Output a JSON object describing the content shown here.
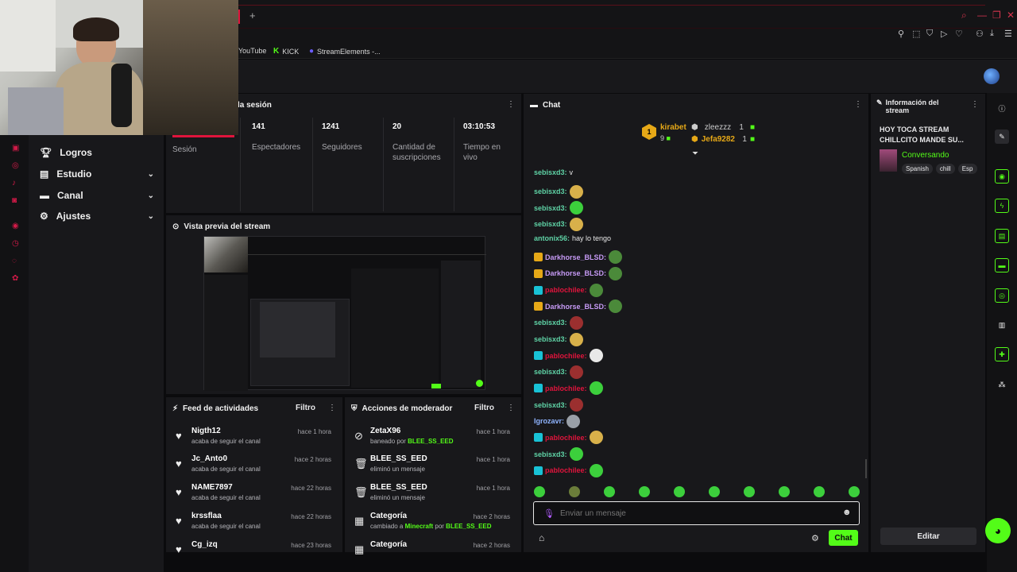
{
  "browser": {
    "new_tab": "+",
    "bookmarks": [
      {
        "icon": "youtube-icon",
        "label": "YouTube"
      },
      {
        "icon": "kick-icon",
        "label": "KICK"
      },
      {
        "icon": "streamelements-icon",
        "label": "StreamElements -..."
      }
    ]
  },
  "sidebar": {
    "items": [
      {
        "label": "Logros",
        "icon": "trophy-icon",
        "chevron": false
      },
      {
        "label": "Estudio",
        "icon": "studio-icon",
        "chevron": true
      },
      {
        "label": "Canal",
        "icon": "channel-icon",
        "chevron": true
      },
      {
        "label": "Ajustes",
        "icon": "gear-icon",
        "chevron": true
      }
    ]
  },
  "session": {
    "title": "la sesión",
    "left_label": "Sesión",
    "stats": [
      {
        "value": "141",
        "label": "Espectadores"
      },
      {
        "value": "1241",
        "label": "Seguidores"
      },
      {
        "value": "20",
        "label": "Cantidad de suscripciones"
      },
      {
        "value": "03:10:53",
        "label": "Tiempo en vivo"
      }
    ]
  },
  "preview": {
    "title": "Vista previa del stream"
  },
  "activity": {
    "title": "Feed de actividades",
    "filter": "Filtro",
    "rows": [
      {
        "name": "Nigth12",
        "sub": "acaba de seguir el canal",
        "time": "hace 1 hora"
      },
      {
        "name": "Jc_Anto0",
        "sub": "acaba de seguir el canal",
        "time": "hace 2 horas"
      },
      {
        "name": "NAME7897",
        "sub": "acaba de seguir el canal",
        "time": "hace 22 horas"
      },
      {
        "name": "krssflaa",
        "sub": "acaba de seguir el canal",
        "time": "hace 22 horas"
      },
      {
        "name": "Cg_izq",
        "sub": "",
        "time": "hace 23 horas"
      }
    ]
  },
  "mod": {
    "title": "Acciones de moderador",
    "filter": "Filtro",
    "rows": [
      {
        "name": "ZetaX96",
        "sub_pre": "baneado por ",
        "sub_hl": "BLEE_SS_EED",
        "sub_mid": "",
        "sub_hl2": "",
        "time": "hace 1 hora",
        "icon": "ban-icon"
      },
      {
        "name": "BLEE_SS_EED",
        "sub_pre": "eliminó un mensaje",
        "sub_hl": "",
        "sub_mid": "",
        "sub_hl2": "",
        "time": "hace 1 hora",
        "icon": "trash-icon"
      },
      {
        "name": "BLEE_SS_EED",
        "sub_pre": "eliminó un mensaje",
        "sub_hl": "",
        "sub_mid": "",
        "sub_hl2": "",
        "time": "hace 1 hora",
        "icon": "trash-icon"
      },
      {
        "name": "Categoría",
        "sub_pre": "cambiado a ",
        "sub_hl": "Minecraft",
        "sub_mid": " por ",
        "sub_hl2": "BLEE_SS_EED",
        "time": "hace 2 horas",
        "icon": "calendar-icon"
      },
      {
        "name": "Categoría",
        "sub_pre": "",
        "sub_hl": "",
        "sub_mid": "",
        "sub_hl2": "",
        "time": "hace 2 horas",
        "icon": "calendar-icon"
      }
    ]
  },
  "chat": {
    "title": "Chat",
    "top_gifters": [
      {
        "rank": "1",
        "name": "kirabet",
        "count": "9"
      },
      {
        "name": "zleezzz",
        "count": "1"
      },
      {
        "name": "Jefa9282",
        "count": "1"
      }
    ],
    "messages": [
      {
        "user": "sebisxd3:",
        "text": "v",
        "color": "#5fd3a6",
        "badge": "",
        "emote": ""
      },
      {
        "user": "sebisxd3:",
        "text": "",
        "color": "#5fd3a6",
        "badge": "",
        "emote": "#d8b04a"
      },
      {
        "user": "sebisxd3:",
        "text": "",
        "color": "#5fd3a6",
        "badge": "",
        "emote": "#3ccf3c"
      },
      {
        "user": "sebisxd3:",
        "text": "",
        "color": "#5fd3a6",
        "badge": "",
        "emote": "#d8b04a"
      },
      {
        "user": "antonix56:",
        "text": "hay lo tengo",
        "color": "#5fd3a6",
        "badge": "",
        "emote": ""
      },
      {
        "user": "Darkhorse_BLSD:",
        "text": "",
        "color": "#c69af5",
        "badge": "#e6a817",
        "emote": "#4b8a3a"
      },
      {
        "user": "Darkhorse_BLSD:",
        "text": "",
        "color": "#c69af5",
        "badge": "#e6a817",
        "emote": "#4b8a3a"
      },
      {
        "user": "pablochilee:",
        "text": "",
        "color": "#e0143c",
        "badge": "#18c2d6",
        "emote": "#4b8a3a"
      },
      {
        "user": "Darkhorse_BLSD:",
        "text": "",
        "color": "#c69af5",
        "badge": "#e6a817",
        "emote": "#4b8a3a"
      },
      {
        "user": "sebisxd3:",
        "text": "",
        "color": "#5fd3a6",
        "badge": "",
        "emote": "#9b2f2f"
      },
      {
        "user": "sebisxd3:",
        "text": "",
        "color": "#5fd3a6",
        "badge": "",
        "emote": "#d8b04a"
      },
      {
        "user": "pablochilee:",
        "text": "",
        "color": "#e0143c",
        "badge": "#18c2d6",
        "emote": "#e8e8e8"
      },
      {
        "user": "sebisxd3:",
        "text": "",
        "color": "#5fd3a6",
        "badge": "",
        "emote": "#9b2f2f"
      },
      {
        "user": "pablochilee:",
        "text": "",
        "color": "#e0143c",
        "badge": "#18c2d6",
        "emote": "#3ccf3c"
      },
      {
        "user": "sebisxd3:",
        "text": "",
        "color": "#5fd3a6",
        "badge": "",
        "emote": "#9b2f2f"
      },
      {
        "user": "Igrozavr:",
        "text": "",
        "color": "#8fb4ff",
        "badge": "",
        "emote": "#9aa0a8"
      },
      {
        "user": "pablochilee:",
        "text": "",
        "color": "#e0143c",
        "badge": "#18c2d6",
        "emote": "#d8b04a"
      },
      {
        "user": "sebisxd3:",
        "text": "",
        "color": "#5fd3a6",
        "badge": "",
        "emote": "#3ccf3c"
      },
      {
        "user": "pablochilee:",
        "text": "",
        "color": "#e0143c",
        "badge": "#18c2d6",
        "emote": "#3ccf3c"
      }
    ],
    "input_placeholder": "Enviar un mensaje",
    "send_label": "Chat"
  },
  "stream_info": {
    "title": "Información del stream",
    "stream_title": "HOY TOCA STREAM CHILLCITO MANDE SU...",
    "category": "Conversando",
    "tags": [
      "Spanish",
      "chill",
      "Esp"
    ],
    "edit_label": "Editar"
  },
  "colors": {
    "accent": "#53fc18",
    "brand_red": "#e0143c",
    "panel": "#18181b"
  }
}
